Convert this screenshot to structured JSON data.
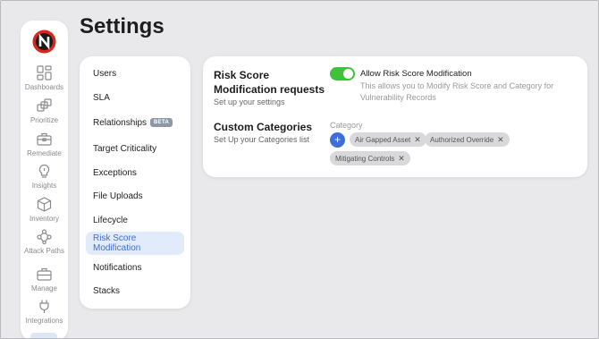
{
  "page": {
    "title": "Settings"
  },
  "sidebar": {
    "items": [
      {
        "label": "Dashboards",
        "icon": "dashboard-icon"
      },
      {
        "label": "Prioritize",
        "icon": "layers-icon"
      },
      {
        "label": "Remediate",
        "icon": "toolbox-icon"
      },
      {
        "label": "Insights",
        "icon": "lightbulb-icon"
      },
      {
        "label": "Inventory",
        "icon": "cube-icon"
      },
      {
        "label": "Attack Paths",
        "icon": "network-icon"
      },
      {
        "label": "Manage",
        "icon": "briefcase-icon"
      },
      {
        "label": "Integrations",
        "icon": "plug-icon"
      }
    ]
  },
  "menu": {
    "items": [
      {
        "label": "Users"
      },
      {
        "label": "SLA"
      },
      {
        "label": "Relationships",
        "badge": "BETA"
      },
      {
        "label": "Target Criticality"
      },
      {
        "label": "Exceptions"
      },
      {
        "label": "File Uploads"
      },
      {
        "label": "Lifecycle"
      },
      {
        "label": "Risk Score Modification",
        "active": true
      },
      {
        "label": "Notifications"
      },
      {
        "label": "Stacks"
      }
    ]
  },
  "risk_section": {
    "title": "Risk Score Modification requests",
    "subtitle": "Set up your settings",
    "toggle_label": "Allow Risk Score Modification",
    "toggle_on": true,
    "toggle_description": "This allows you to Modify Risk Score and Category for Vulnerability Records"
  },
  "categories_section": {
    "title": "Custom Categories",
    "subtitle": "Set Up your Categories list",
    "field_label": "Category",
    "add_symbol": "+",
    "chips": [
      "Air Gapped Asset",
      "Authorized Override",
      "Mitigating Controls"
    ],
    "remove_symbol": "✕"
  },
  "colors": {
    "accent": "#3e6fd8",
    "toggle_on": "#3fc13a",
    "active_menu_bg": "#e2ebfa",
    "logo_red": "#d9261c"
  }
}
